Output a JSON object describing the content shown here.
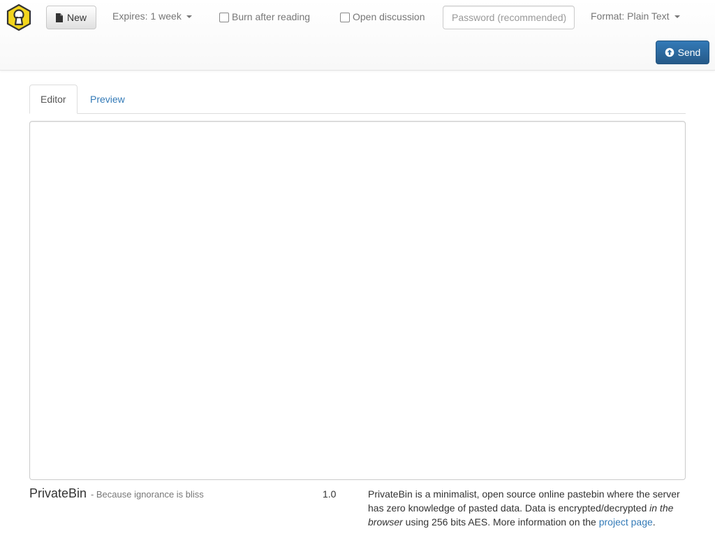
{
  "navbar": {
    "logo_icon": "keyhole-hexagon-icon",
    "new_button": {
      "label": "New",
      "icon": "file-icon"
    },
    "expires": {
      "label": "Expires: 1 week"
    },
    "burn_after_reading": {
      "label": "Burn after reading",
      "checked": false
    },
    "open_discussion": {
      "label": "Open discussion",
      "checked": false
    },
    "password": {
      "placeholder": "Password (recommended)",
      "value": ""
    },
    "format": {
      "label": "Format: Plain Text"
    },
    "send_button": {
      "label": "Send",
      "icon": "circle-arrow-up-icon"
    }
  },
  "tabs": [
    {
      "label": "Editor",
      "active": true
    },
    {
      "label": "Preview",
      "active": false
    }
  ],
  "editor": {
    "value": ""
  },
  "footer": {
    "brand_name": "PrivateBin",
    "brand_tagline": "- Because ignorance is bliss",
    "version": "1.0",
    "about": {
      "part1": "PrivateBin is a minimalist, open source online pastebin where the server has zero knowledge of pasted data. Data is encrypted/decrypted ",
      "emphasis": "in the browser",
      "part2": " using 256 bits AES. More information on the ",
      "link_text": "project page",
      "part3": "."
    }
  },
  "colors": {
    "primary": "#337ab7",
    "logo_yellow": "#f2d51e",
    "navbar_text": "#777777",
    "border": "#cccccc"
  }
}
